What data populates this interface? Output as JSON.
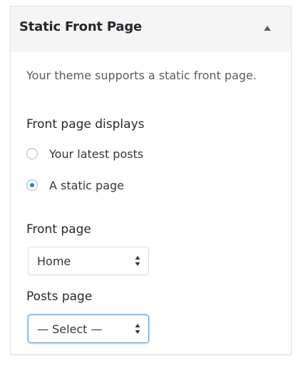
{
  "panel": {
    "title": "Static Front Page",
    "description": "Your theme supports a static front page."
  },
  "front_page_displays": {
    "label": "Front page displays",
    "options": [
      {
        "label": "Your latest posts",
        "checked": false
      },
      {
        "label": "A static page",
        "checked": true
      }
    ]
  },
  "front_page": {
    "label": "Front page",
    "selected": "Home"
  },
  "posts_page": {
    "label": "Posts page",
    "selected": "— Select —"
  },
  "colors": {
    "accent": "#1e8cbe",
    "focus_border": "#5b9dd9",
    "header_bg": "#f5f5f5"
  },
  "icons": {
    "collapse": "triangle-up-icon",
    "select_arrows": "up-down-arrows-icon"
  }
}
